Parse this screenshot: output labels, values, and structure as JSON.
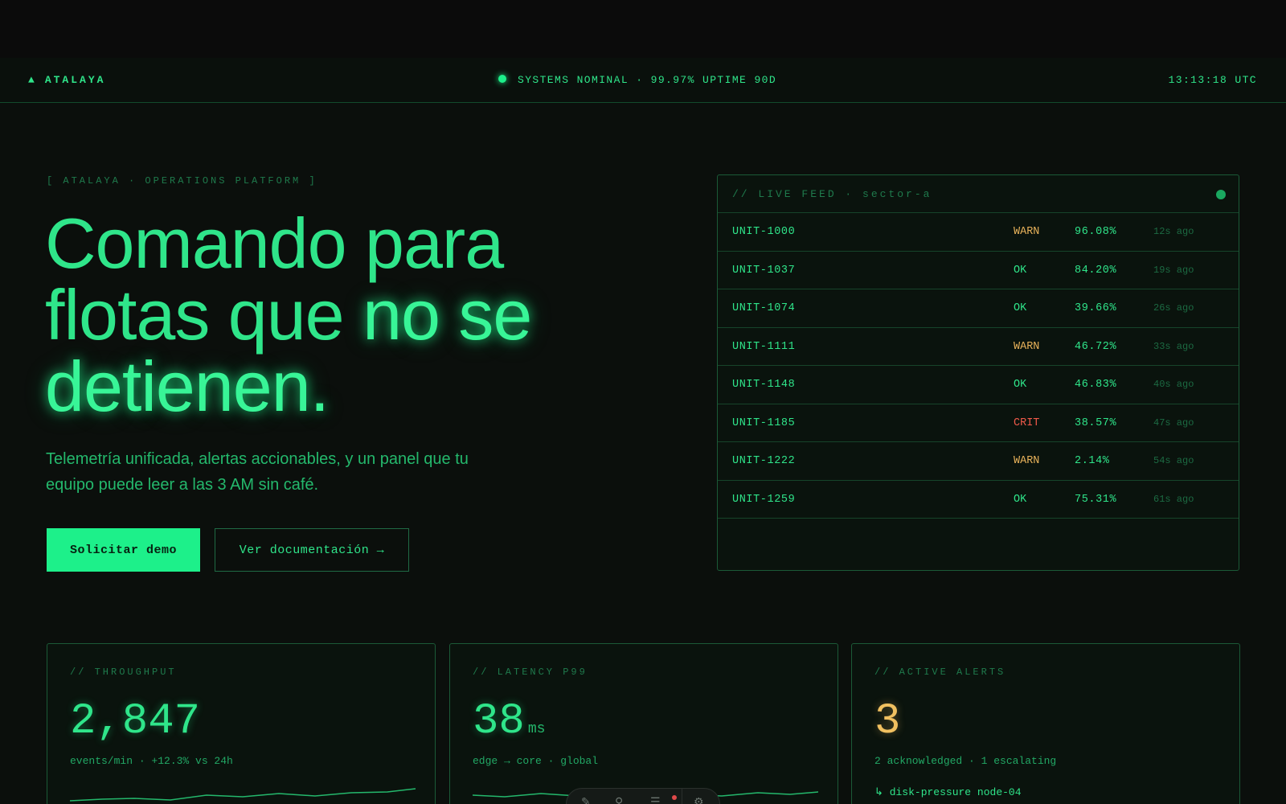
{
  "header": {
    "brand_icon": "triangle-icon",
    "brand": "ATALAYA",
    "status": "SYSTEMS NOMINAL · 99.97% UPTIME 90D",
    "clock": "13:13:18 UTC"
  },
  "hero": {
    "eyebrow": "[ ATALAYA · OPERATIONS PLATFORM ]",
    "headline_a": "Comando para",
    "headline_b": "flotas que ",
    "headline_c": "no se",
    "headline_d": "detienen.",
    "subhead": "Telemetría unificada, alertas accionables, y un panel que tu equipo puede leer a las 3 AM sin café.",
    "primary_cta": "Solicitar demo",
    "secondary_cta": "Ver documentación →"
  },
  "feed": {
    "title": "// LIVE FEED · sector-a",
    "rows": [
      {
        "unit": "UNIT-1000",
        "state": "WARN",
        "pct": "96.08%",
        "ago": "12s ago"
      },
      {
        "unit": "UNIT-1037",
        "state": "OK",
        "pct": "84.20%",
        "ago": "19s ago"
      },
      {
        "unit": "UNIT-1074",
        "state": "OK",
        "pct": "39.66%",
        "ago": "26s ago"
      },
      {
        "unit": "UNIT-1111",
        "state": "WARN",
        "pct": "46.72%",
        "ago": "33s ago"
      },
      {
        "unit": "UNIT-1148",
        "state": "OK",
        "pct": "46.83%",
        "ago": "40s ago"
      },
      {
        "unit": "UNIT-1185",
        "state": "CRIT",
        "pct": "38.57%",
        "ago": "47s ago"
      },
      {
        "unit": "UNIT-1222",
        "state": "WARN",
        "pct": "2.14%",
        "ago": "54s ago"
      },
      {
        "unit": "UNIT-1259",
        "state": "OK",
        "pct": "75.31%",
        "ago": "61s ago"
      }
    ]
  },
  "metrics": {
    "throughput": {
      "label": "// THROUGHPUT",
      "value": "2,847",
      "meta": "events/min · +12.3% vs 24h"
    },
    "latency": {
      "label": "// LATENCY P99",
      "value": "38",
      "unit": "ms",
      "meta": "edge → core · global"
    },
    "alerts": {
      "label": "// ACTIVE ALERTS",
      "value": "3",
      "meta": "2 acknowledged · 1 escalating",
      "item": "↳ disk-pressure node-04"
    }
  },
  "colors": {
    "accent": "#1df08a",
    "text": "#2fe58a",
    "warn": "#e8b25a",
    "crit": "#f05a4a",
    "background": "#0b0f0c"
  },
  "dock": {
    "icons": [
      "annotate-icon",
      "pin-icon",
      "list-icon",
      "settings-icon"
    ]
  }
}
